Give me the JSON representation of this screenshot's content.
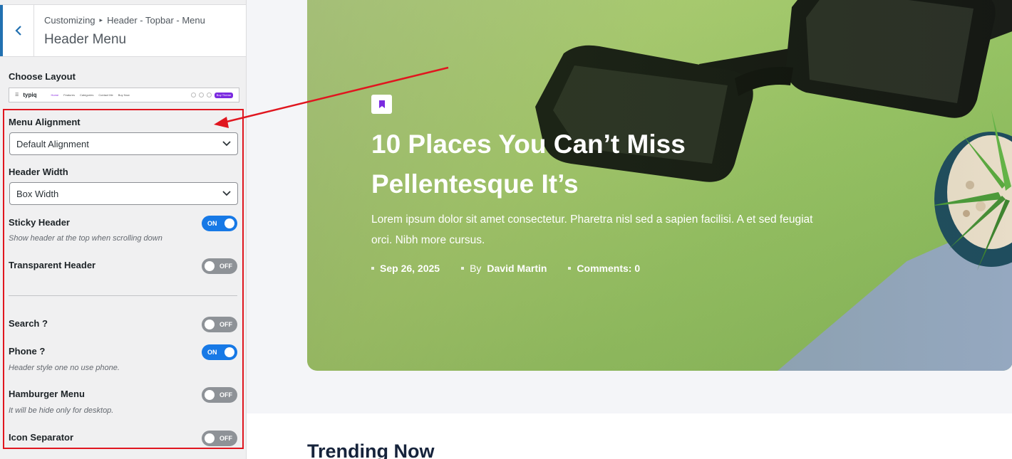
{
  "sidebar": {
    "breadcrumb": {
      "root": "Customizing",
      "path": "Header - Topbar - Menu"
    },
    "title": "Header Menu",
    "choose_layout": {
      "label": "Choose Layout",
      "preview": {
        "logo": "typiq",
        "menu": [
          "Home",
          "Features",
          "Categories",
          "Contact Me",
          "Buy Now"
        ],
        "button": "Buy Theme"
      }
    },
    "menu_alignment": {
      "label": "Menu Alignment",
      "value": "Default Alignment"
    },
    "header_width": {
      "label": "Header Width",
      "value": "Box Width"
    },
    "sticky_header": {
      "label": "Sticky Header",
      "desc": "Show header at the top when scrolling down",
      "state": "ON"
    },
    "transparent_header": {
      "label": "Transparent Header",
      "state": "OFF"
    },
    "search": {
      "label": "Search ?",
      "state": "OFF"
    },
    "phone": {
      "label": "Phone ?",
      "desc": "Header style one no use phone.",
      "state": "ON"
    },
    "hamburger_menu": {
      "label": "Hamburger Menu",
      "desc": "It will be hide only for desktop.",
      "state": "OFF"
    },
    "icon_separator": {
      "label": "Icon Separator",
      "state": "OFF"
    }
  },
  "hero": {
    "title_line1": "10 Places You Can’t Miss",
    "title_line2": "Pellentesque It’s",
    "excerpt": "Lorem ipsum dolor sit amet consectetur. Pharetra nisl sed a sapien facilisi. A et sed feugiat orci. Nibh more cursus.",
    "date": "Sep 26, 2025",
    "by_label": "By",
    "author": "David Martin",
    "comments": "Comments: 0"
  },
  "section": {
    "trending": "Trending Now"
  },
  "colors": {
    "accent": "#2271b1",
    "toggle_on": "#1779e6",
    "toggle_off": "#8e9297",
    "highlight": "#e0161f",
    "badge_icon": "#7b2be0"
  }
}
